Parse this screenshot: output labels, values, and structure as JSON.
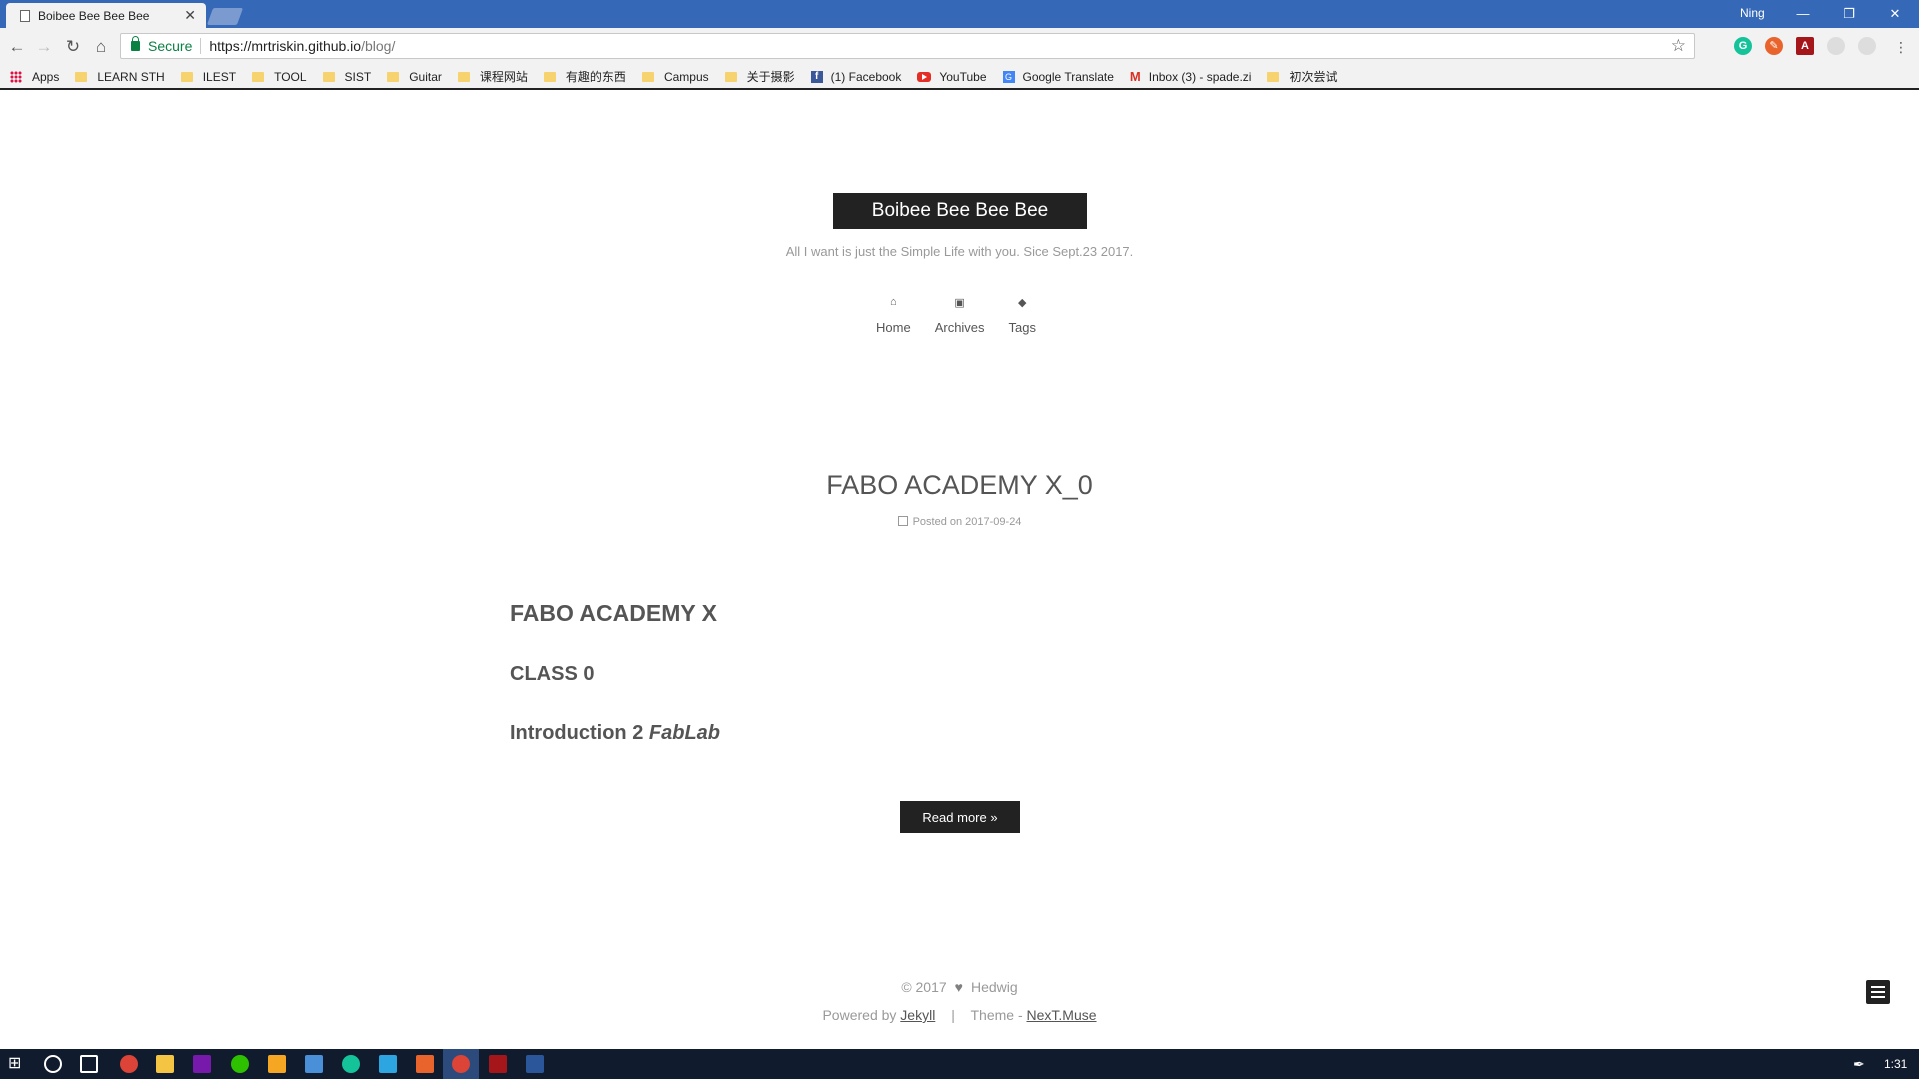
{
  "browser": {
    "tab_title": "Boibee Bee Bee Bee",
    "tab_close": "✕",
    "profile_name": "Ning",
    "secure_label": "Secure",
    "url_host": "https://mrtriskin.github.io",
    "url_path": "/blog/",
    "bookmarks": [
      {
        "label": "Apps",
        "icon": "apps-icon"
      },
      {
        "label": "LEARN STH",
        "icon": "folder-icon"
      },
      {
        "label": "ILEST",
        "icon": "folder-icon"
      },
      {
        "label": "TOOL",
        "icon": "folder-icon"
      },
      {
        "label": "SIST",
        "icon": "folder-icon"
      },
      {
        "label": "Guitar",
        "icon": "folder-icon"
      },
      {
        "label": "课程网站",
        "icon": "folder-icon"
      },
      {
        "label": "有趣的东西",
        "icon": "folder-icon"
      },
      {
        "label": "Campus",
        "icon": "folder-icon"
      },
      {
        "label": "关于摄影",
        "icon": "folder-icon"
      },
      {
        "label": "(1) Facebook",
        "icon": "facebook-icon"
      },
      {
        "label": "YouTube",
        "icon": "youtube-icon"
      },
      {
        "label": "Google Translate",
        "icon": "google-translate-icon"
      },
      {
        "label": "Inbox (3) - spade.zi",
        "icon": "gmail-icon"
      },
      {
        "label": "初次尝试",
        "icon": "folder-icon"
      }
    ]
  },
  "site": {
    "brand": "Boibee Bee Bee Bee",
    "subtitle": "All I want is just the Simple Life with you. Sice Sept.23 2017.",
    "menu": [
      {
        "label": "Home",
        "icon": "home-icon"
      },
      {
        "label": "Archives",
        "icon": "archive-icon"
      },
      {
        "label": "Tags",
        "icon": "tags-icon"
      }
    ]
  },
  "post": {
    "title": "FABO ACADEMY X_0",
    "meta": "Posted on 2017-09-24",
    "heading1": "FABO ACADEMY X",
    "heading2": "CLASS 0",
    "heading3_prefix": "Introduction 2 ",
    "heading3_em": "FabLab",
    "read_more": "Read more »"
  },
  "footer": {
    "copyright_year": "© 2017",
    "author": "Hedwig",
    "powered_prefix": "Powered by",
    "powered_link": "Jekyll",
    "separator": "|",
    "theme_prefix": "Theme -",
    "theme_link": "NexT.Muse"
  },
  "taskbar": {
    "clock": "1:31"
  },
  "colors": {
    "chrome_blue": "#3568b7",
    "brand_bg": "#222222",
    "taskbar_bg": "#101c2e",
    "secure_green": "#0b8043"
  }
}
